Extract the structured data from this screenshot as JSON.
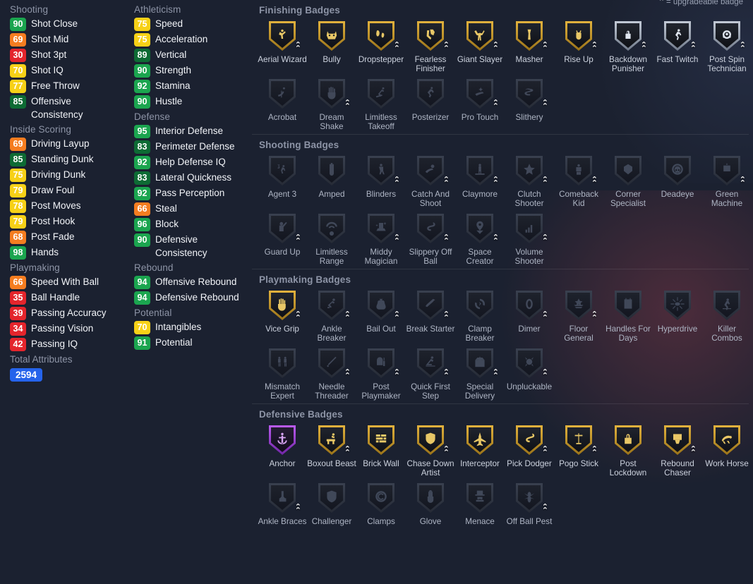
{
  "legend": {
    "symbol": "⌃",
    "text": "= upgradeable badge"
  },
  "attributes": {
    "total_label": "Total Attributes",
    "total_value": "2594",
    "columns": [
      {
        "groups": [
          {
            "name": "Shooting",
            "items": [
              {
                "value": "90",
                "label": "Shot Close",
                "tier": "green"
              },
              {
                "value": "69",
                "label": "Shot Mid",
                "tier": "orange"
              },
              {
                "value": "30",
                "label": "Shot 3pt",
                "tier": "red"
              },
              {
                "value": "70",
                "label": "Shot IQ",
                "tier": "yellow"
              },
              {
                "value": "77",
                "label": "Free Throw",
                "tier": "yellow"
              },
              {
                "value": "85",
                "label": "Offensive Consistency",
                "tier": "darkgreen"
              }
            ]
          },
          {
            "name": "Inside Scoring",
            "items": [
              {
                "value": "69",
                "label": "Driving Layup",
                "tier": "orange"
              },
              {
                "value": "85",
                "label": "Standing Dunk",
                "tier": "darkgreen"
              },
              {
                "value": "75",
                "label": "Driving Dunk",
                "tier": "yellow"
              },
              {
                "value": "79",
                "label": "Draw Foul",
                "tier": "yellow"
              },
              {
                "value": "78",
                "label": "Post Moves",
                "tier": "yellow"
              },
              {
                "value": "79",
                "label": "Post Hook",
                "tier": "yellow"
              },
              {
                "value": "68",
                "label": "Post Fade",
                "tier": "orange"
              },
              {
                "value": "98",
                "label": "Hands",
                "tier": "green"
              }
            ]
          },
          {
            "name": "Playmaking",
            "items": [
              {
                "value": "66",
                "label": "Speed With Ball",
                "tier": "orange"
              },
              {
                "value": "35",
                "label": "Ball Handle",
                "tier": "red"
              },
              {
                "value": "39",
                "label": "Passing Accuracy",
                "tier": "red"
              },
              {
                "value": "34",
                "label": "Passing Vision",
                "tier": "red"
              },
              {
                "value": "42",
                "label": "Passing IQ",
                "tier": "red"
              }
            ]
          }
        ]
      },
      {
        "groups": [
          {
            "name": "Athleticism",
            "items": [
              {
                "value": "75",
                "label": "Speed",
                "tier": "yellow"
              },
              {
                "value": "75",
                "label": "Acceleration",
                "tier": "yellow"
              },
              {
                "value": "89",
                "label": "Vertical",
                "tier": "darkgreen"
              },
              {
                "value": "90",
                "label": "Strength",
                "tier": "green"
              },
              {
                "value": "92",
                "label": "Stamina",
                "tier": "green"
              },
              {
                "value": "90",
                "label": "Hustle",
                "tier": "green"
              }
            ]
          },
          {
            "name": "Defense",
            "items": [
              {
                "value": "95",
                "label": "Interior Defense",
                "tier": "green"
              },
              {
                "value": "83",
                "label": "Perimeter Defense",
                "tier": "darkgreen"
              },
              {
                "value": "92",
                "label": "Help Defense IQ",
                "tier": "green"
              },
              {
                "value": "83",
                "label": "Lateral Quickness",
                "tier": "darkgreen"
              },
              {
                "value": "92",
                "label": "Pass Perception",
                "tier": "green"
              },
              {
                "value": "66",
                "label": "Steal",
                "tier": "orange"
              },
              {
                "value": "96",
                "label": "Block",
                "tier": "green"
              },
              {
                "value": "90",
                "label": "Defensive Consistency",
                "tier": "green"
              }
            ]
          },
          {
            "name": "Rebound",
            "items": [
              {
                "value": "94",
                "label": "Offensive Rebound",
                "tier": "green"
              },
              {
                "value": "94",
                "label": "Defensive Rebound",
                "tier": "green"
              }
            ]
          },
          {
            "name": "Potential",
            "items": [
              {
                "value": "70",
                "label": "Intangibles",
                "tier": "yellow"
              },
              {
                "value": "91",
                "label": "Potential",
                "tier": "green"
              }
            ]
          }
        ]
      }
    ],
    "tier_colors": {
      "green": "#1ba54f",
      "darkgreen": "#0d6b34",
      "yellow": "#f7d117",
      "orange": "#f57d20",
      "red": "#e4252c",
      "blue": "#2563eb"
    }
  },
  "badge_tier_colors": {
    "gold": "#d6a game",
    "gold_border": "#e0b23c",
    "silver_border": "#b9c0cb",
    "hof_border": "#b455e8",
    "locked_border": "#3a4253"
  },
  "badge_sections": [
    {
      "title": "Finishing Badges",
      "badges": [
        {
          "name": "Aerial Wizard",
          "tier": "gold",
          "upgradeable": true,
          "icon": "dunk-icon"
        },
        {
          "name": "Bully",
          "tier": "gold",
          "upgradeable": false,
          "icon": "bulldog-icon"
        },
        {
          "name": "Dropstepper",
          "tier": "gold",
          "upgradeable": true,
          "icon": "footprints-icon"
        },
        {
          "name": "Fearless Finisher",
          "tier": "gold",
          "upgradeable": true,
          "icon": "spartan-helmet-icon"
        },
        {
          "name": "Giant Slayer",
          "tier": "gold",
          "upgradeable": true,
          "icon": "arms-raised-icon"
        },
        {
          "name": "Masher",
          "tier": "gold",
          "upgradeable": true,
          "icon": "mallet-icon"
        },
        {
          "name": "Rise Up",
          "tier": "gold",
          "upgradeable": true,
          "icon": "raised-fist-icon"
        },
        {
          "name": "Backdown Punisher",
          "tier": "silver",
          "upgradeable": true,
          "icon": "padlock-icon"
        },
        {
          "name": "Fast Twitch",
          "tier": "silver",
          "upgradeable": true,
          "icon": "sprinting-player-icon"
        },
        {
          "name": "Post Spin Technician",
          "tier": "silver",
          "upgradeable": true,
          "icon": "spinner-icon"
        },
        {
          "name": "Acrobat",
          "tier": "locked",
          "upgradeable": false,
          "icon": "acrobat-icon"
        },
        {
          "name": "Dream Shake",
          "tier": "locked",
          "upgradeable": true,
          "icon": "hand-icon"
        },
        {
          "name": "Limitless Takeoff",
          "tier": "locked",
          "upgradeable": false,
          "icon": "leaping-player-icon"
        },
        {
          "name": "Posterizer",
          "tier": "locked",
          "upgradeable": false,
          "icon": "slam-dunk-icon"
        },
        {
          "name": "Pro Touch",
          "tier": "locked",
          "upgradeable": true,
          "icon": "sparkle-hand-icon"
        },
        {
          "name": "Slithery",
          "tier": "locked",
          "upgradeable": true,
          "icon": "snake-icon"
        }
      ]
    },
    {
      "title": "Shooting Badges",
      "badges": [
        {
          "name": "Agent 3",
          "tier": "locked",
          "upgradeable": false,
          "icon": "three-shooter-icon"
        },
        {
          "name": "Amped",
          "tier": "locked",
          "upgradeable": false,
          "icon": "battery-icon"
        },
        {
          "name": "Blinders",
          "tier": "locked",
          "upgradeable": true,
          "icon": "contested-shot-icon"
        },
        {
          "name": "Catch And Shoot",
          "tier": "locked",
          "upgradeable": true,
          "icon": "catching-hand-icon"
        },
        {
          "name": "Claymore",
          "tier": "locked",
          "upgradeable": true,
          "icon": "standing-figure-icon"
        },
        {
          "name": "Clutch Shooter",
          "tier": "locked",
          "upgradeable": true,
          "icon": "star-icon"
        },
        {
          "name": "Comeback Kid",
          "tier": "locked",
          "upgradeable": true,
          "icon": "scoreboard-figure-icon"
        },
        {
          "name": "Corner Specialist",
          "tier": "locked",
          "upgradeable": false,
          "icon": "corner-icon"
        },
        {
          "name": "Deadeye",
          "tier": "locked",
          "upgradeable": false,
          "icon": "skull-target-icon"
        },
        {
          "name": "Green Machine",
          "tier": "locked",
          "upgradeable": true,
          "icon": "robot-icon"
        },
        {
          "name": "Guard Up",
          "tier": "locked",
          "upgradeable": true,
          "icon": "defender-hand-icon"
        },
        {
          "name": "Limitless Range",
          "tier": "locked",
          "upgradeable": false,
          "icon": "signal-waves-icon"
        },
        {
          "name": "Middy Magician",
          "tier": "locked",
          "upgradeable": true,
          "icon": "magic-hat-icon"
        },
        {
          "name": "Slippery Off Ball",
          "tier": "locked",
          "upgradeable": true,
          "icon": "snake-curve-icon"
        },
        {
          "name": "Space Creator",
          "tier": "locked",
          "upgradeable": true,
          "icon": "map-pin-icon"
        },
        {
          "name": "Volume Shooter",
          "tier": "locked",
          "upgradeable": true,
          "icon": "bar-chart-icon"
        }
      ]
    },
    {
      "title": "Playmaking Badges",
      "badges": [
        {
          "name": "Vice Grip",
          "tier": "gold",
          "upgradeable": true,
          "icon": "gripping-hand-icon"
        },
        {
          "name": "Ankle Breaker",
          "tier": "locked",
          "upgradeable": true,
          "icon": "crossover-icon"
        },
        {
          "name": "Bail Out",
          "tier": "locked",
          "upgradeable": true,
          "icon": "money-bag-icon"
        },
        {
          "name": "Break Starter",
          "tier": "locked",
          "upgradeable": true,
          "icon": "outlet-pass-icon"
        },
        {
          "name": "Clamp Breaker",
          "tier": "locked",
          "upgradeable": false,
          "icon": "broken-clamp-icon"
        },
        {
          "name": "Dimer",
          "tier": "locked",
          "upgradeable": true,
          "icon": "dime-coin-icon"
        },
        {
          "name": "Floor General",
          "tier": "locked",
          "upgradeable": true,
          "icon": "general-insignia-icon"
        },
        {
          "name": "Handles For Days",
          "tier": "locked",
          "upgradeable": false,
          "icon": "calendar-one-icon"
        },
        {
          "name": "Hyperdrive",
          "tier": "locked",
          "upgradeable": false,
          "icon": "warp-speed-icon"
        },
        {
          "name": "Killer Combos",
          "tier": "locked",
          "upgradeable": false,
          "icon": "dribbler-icon"
        },
        {
          "name": "Mismatch Expert",
          "tier": "locked",
          "upgradeable": false,
          "icon": "mismatch-icon"
        },
        {
          "name": "Needle Threader",
          "tier": "locked",
          "upgradeable": true,
          "icon": "needle-icon"
        },
        {
          "name": "Post Playmaker",
          "tier": "locked",
          "upgradeable": true,
          "icon": "mailbox-icon"
        },
        {
          "name": "Quick First Step",
          "tier": "locked",
          "upgradeable": true,
          "icon": "first-step-icon"
        },
        {
          "name": "Special Delivery",
          "tier": "locked",
          "upgradeable": true,
          "icon": "delivery-box-icon"
        },
        {
          "name": "Unpluckable",
          "tier": "locked",
          "upgradeable": true,
          "icon": "protected-ball-icon"
        }
      ]
    },
    {
      "title": "Defensive Badges",
      "badges": [
        {
          "name": "Anchor",
          "tier": "hof",
          "upgradeable": false,
          "icon": "anchor-icon"
        },
        {
          "name": "Boxout Beast",
          "tier": "gold",
          "upgradeable": true,
          "icon": "boxout-icon"
        },
        {
          "name": "Brick Wall",
          "tier": "gold",
          "upgradeable": false,
          "icon": "brick-wall-icon"
        },
        {
          "name": "Chase Down Artist",
          "tier": "gold",
          "upgradeable": true,
          "icon": "shield-star-icon"
        },
        {
          "name": "Interceptor",
          "tier": "gold",
          "upgradeable": false,
          "icon": "jet-icon"
        },
        {
          "name": "Pick Dodger",
          "tier": "gold",
          "upgradeable": true,
          "icon": "dodge-path-icon"
        },
        {
          "name": "Pogo Stick",
          "tier": "gold",
          "upgradeable": true,
          "icon": "pogo-icon"
        },
        {
          "name": "Post Lockdown",
          "tier": "gold",
          "upgradeable": false,
          "icon": "lock-icon"
        },
        {
          "name": "Rebound Chaser",
          "tier": "gold",
          "upgradeable": true,
          "icon": "rebound-hoop-icon"
        },
        {
          "name": "Work Horse",
          "tier": "gold",
          "upgradeable": false,
          "icon": "horse-icon"
        },
        {
          "name": "Ankle Braces",
          "tier": "locked",
          "upgradeable": true,
          "icon": "ankle-brace-icon"
        },
        {
          "name": "Challenger",
          "tier": "locked",
          "upgradeable": false,
          "icon": "shield-c-icon"
        },
        {
          "name": "Clamps",
          "tier": "locked",
          "upgradeable": false,
          "icon": "clamp-icon"
        },
        {
          "name": "Glove",
          "tier": "locked",
          "upgradeable": false,
          "icon": "glove-icon"
        },
        {
          "name": "Menace",
          "tier": "locked",
          "upgradeable": false,
          "icon": "top-hat-figure-icon"
        },
        {
          "name": "Off Ball Pest",
          "tier": "locked",
          "upgradeable": true,
          "icon": "pest-bug-icon"
        }
      ]
    }
  ]
}
